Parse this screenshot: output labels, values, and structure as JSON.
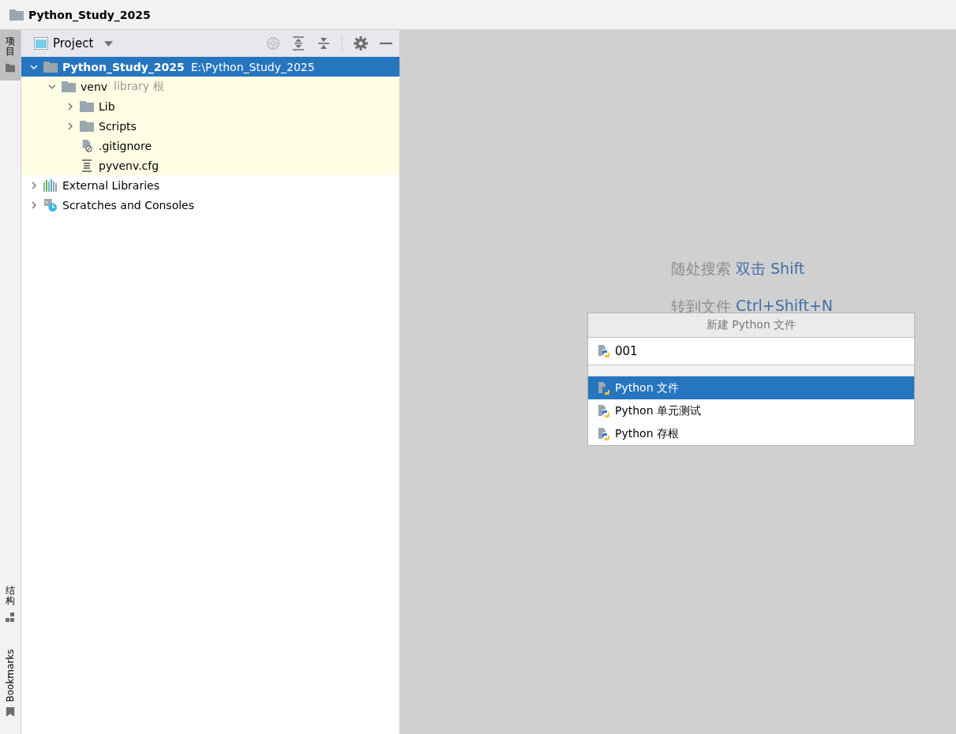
{
  "window": {
    "title": "Python_Study_2025"
  },
  "left_strip": {
    "top_tabs": [
      {
        "label": "项目",
        "selected": true
      }
    ],
    "bottom_tabs": [
      {
        "label": "结构",
        "kind": "cjk",
        "selected": false
      },
      {
        "label": "Bookmarks",
        "kind": "latin",
        "selected": false
      }
    ]
  },
  "project_panel": {
    "title": "Project",
    "tree": [
      {
        "label": "Python_Study_2025",
        "hint": "E:\\Python_Study_2025",
        "kind": "folder",
        "expanded": true,
        "selected": true,
        "children": [
          {
            "label": "venv",
            "hint": "library 根",
            "kind": "folder",
            "expanded": true,
            "selected": false,
            "library": true,
            "children": [
              {
                "label": "Lib",
                "kind": "folder",
                "expanded": false,
                "selected": false,
                "library": true
              },
              {
                "label": "Scripts",
                "kind": "folder",
                "expanded": false,
                "selected": false,
                "library": true
              },
              {
                "label": ".gitignore",
                "kind": "ignore-file",
                "selected": false,
                "library": true
              },
              {
                "label": "pyvenv.cfg",
                "kind": "config-file",
                "selected": false,
                "library": true
              }
            ]
          }
        ]
      },
      {
        "label": "External Libraries",
        "kind": "libraries",
        "expanded": false,
        "selected": false,
        "library": false
      },
      {
        "label": "Scratches and Consoles",
        "kind": "scratches",
        "expanded": false,
        "selected": false,
        "library": false
      }
    ]
  },
  "editor_hints": [
    {
      "label": "随处搜索",
      "shortcut": "双击 Shift"
    },
    {
      "label": "转到文件",
      "shortcut": "Ctrl+Shift+N"
    }
  ],
  "new_file_popup": {
    "title": "新建 Python 文件",
    "value": "001",
    "items": [
      {
        "label": "Python 文件",
        "selected": true
      },
      {
        "label": "Python 单元测试",
        "selected": false
      },
      {
        "label": "Python 存根",
        "selected": false
      }
    ]
  }
}
